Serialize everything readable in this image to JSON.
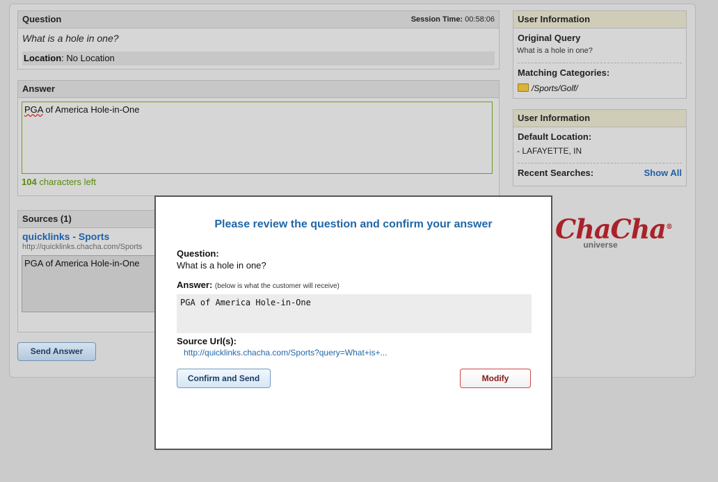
{
  "question_panel": {
    "header": "Question",
    "session_label": "Session Time:",
    "session_time": "00:58:06",
    "question_text": "What is a hole in one?",
    "location_label": "Location",
    "location_value": ": No Location"
  },
  "answer_panel": {
    "header": "Answer",
    "answer_misspelled_word": "PGA",
    "answer_rest": " of America Hole-in-One",
    "chars_left_count": "104",
    "chars_left_label": " characters left"
  },
  "sources_panel": {
    "header": "Sources (1)",
    "link_text": "quicklinks - Sports",
    "url_text": "http://quicklinks.chacha.com/Sports",
    "snippet": "PGA of America Hole-in-One"
  },
  "send_button": "Send Answer",
  "user_info_1": {
    "header": "User Information",
    "original_query_label": "Original Query",
    "original_query_value": "What is a hole in one?",
    "matching_categories_label": "Matching Categories:",
    "category": "/Sports/Golf/"
  },
  "user_info_2": {
    "header": "User Information",
    "default_location_label": "Default Location:",
    "default_location_value": "- LAFAYETTE, IN",
    "recent_searches_label": "Recent Searches:",
    "show_all": "Show All"
  },
  "logo": {
    "main": "ChaCha",
    "mark": "®",
    "sub": "universe"
  },
  "modal": {
    "title": "Please review the question and confirm your answer",
    "question_label": "Question:",
    "question_value": "What is a hole in one?",
    "answer_label": "Answer:",
    "answer_note": "(below is what the customer will receive)",
    "answer_value": "PGA of America Hole-in-One",
    "source_label": "Source Url(s):",
    "source_url": "http://quicklinks.chacha.com/Sports?query=What+is+...",
    "confirm_button": "Confirm and Send",
    "modify_button": "Modify"
  }
}
